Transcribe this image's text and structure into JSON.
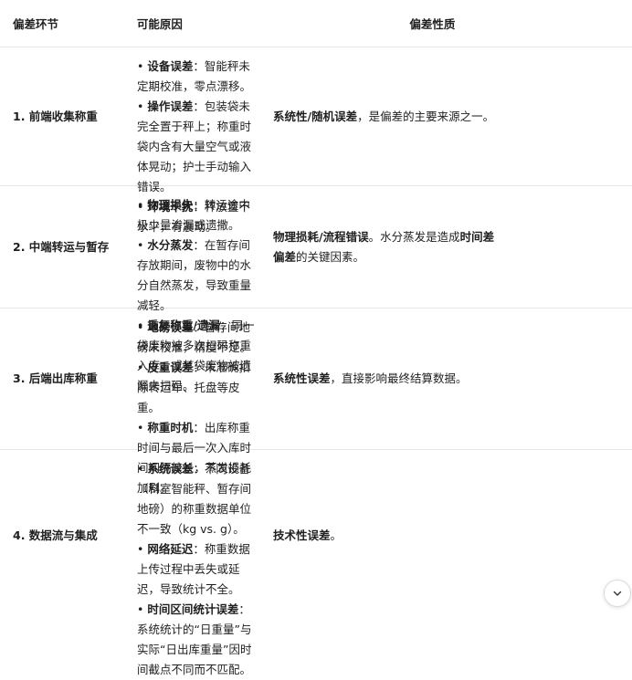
{
  "table": {
    "headers": [
      "偏差环节",
      "可能原因",
      "偏差性质"
    ],
    "rows": [
      {
        "stage": "1. 前端收集称重",
        "reasons": [
          {
            "bold": "设备误差",
            "text": "：智能秤未定期校准，零点漂移。"
          },
          {
            "bold": "操作误差",
            "text": "：包装袋未完全置于秤上；称重时袋内含有大量空气或液体晃动；护士手动输入错误。"
          },
          {
            "bold": "环境干扰",
            "text": "：秤放置不水平，有震动。"
          }
        ],
        "nature": [
          {
            "bold": "系统性/随机误差",
            "text": "，是偏差的主要来源之一。"
          }
        ]
      },
      {
        "stage": "2. 中端转运与暂存",
        "reasons": [
          {
            "bold": "物理损失",
            "text": "：转运途中极少量渗漏或遗撒。"
          },
          {
            "bold": "水分蒸发",
            "text": "：在暂存间存放期间，废物中的水分自然蒸发，导致重量减轻。"
          },
          {
            "bold": "重复称重/遗漏",
            "text": "：同一袋废物被多次扫码称重入库，或某袋废物被遗漏未扫码。"
          }
        ],
        "nature": [
          {
            "bold": "物理损耗/流程错误",
            "text": "。水分蒸发是造成"
          },
          {
            "bold": "时间差偏差",
            "text": "的关键因素。"
          }
        ]
      },
      {
        "stage": "3. 后端出库称重",
        "reasons": [
          {
            "bold": "地磅误差",
            "text": "：暂存间地磅未校准，精度不足。"
          },
          {
            "bold": "皮重误差",
            "text": "：未准确扣除转运车、托盘等皮重。"
          },
          {
            "bold": "称重时机",
            "text": "：出库称重时间与最后一次入库时间间隔较长，蒸发损耗加剧。"
          }
        ],
        "nature": [
          {
            "bold": "系统性误差",
            "text": "，直接影响最终结算数据。"
          }
        ]
      },
      {
        "stage": "4. 数据流与集成",
        "reasons": [
          {
            "bold": "系统误差",
            "text": "：不同设备（科室智能秤、暂存间地磅）的称重数据单位不一致（kg vs. g）。"
          },
          {
            "bold": "网络延迟",
            "text": "：称重数据上传过程中丢失或延迟，导致统计不全。"
          },
          {
            "bold": "时间区间统计误差",
            "text": "：系统统计的“日重量”与实际“日出库重量”因时间截点不同而不匹配。"
          }
        ],
        "nature": [
          {
            "bold": "技术性误差",
            "text": "。"
          }
        ]
      }
    ]
  },
  "bullet": "•",
  "scroll_button_icon": "chevron-down-icon"
}
